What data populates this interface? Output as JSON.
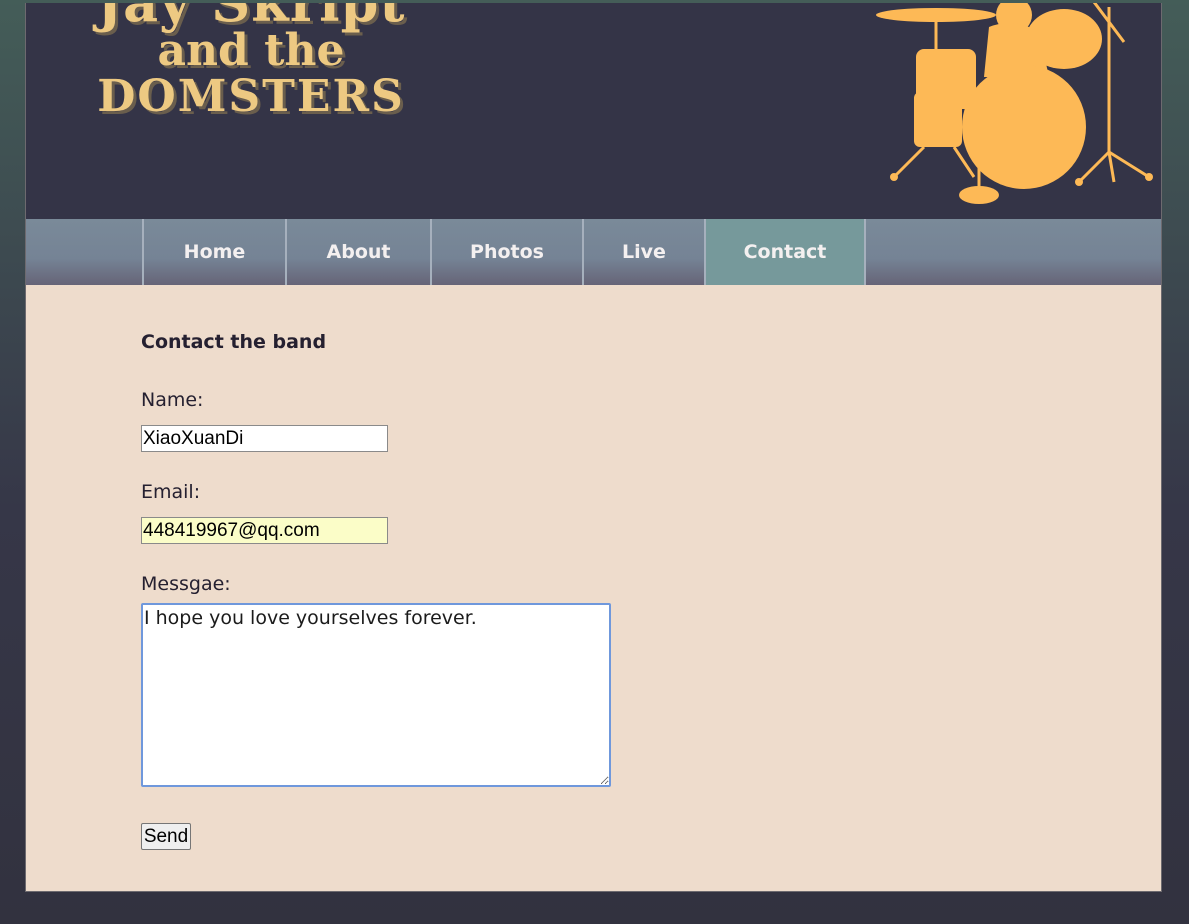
{
  "header": {
    "logo_line1": "Jay Skript",
    "logo_line2": "and the",
    "logo_line3": "DOMSTERS",
    "drum_icon": "drum-kit-silhouette",
    "accent_color": "#fdb956"
  },
  "nav": {
    "items": [
      {
        "label": "Home"
      },
      {
        "label": "About"
      },
      {
        "label": "Photos"
      },
      {
        "label": "Live"
      },
      {
        "label": "Contact",
        "active": true
      }
    ]
  },
  "form": {
    "heading": "Contact the band",
    "name_label": "Name:",
    "name_value": "XiaoXuanDi",
    "email_label": "Email:",
    "email_value": "448419967@qq.com",
    "message_label": "Messgae:",
    "message_value": "I hope you love yourselves forever.",
    "send_label": "Send"
  }
}
